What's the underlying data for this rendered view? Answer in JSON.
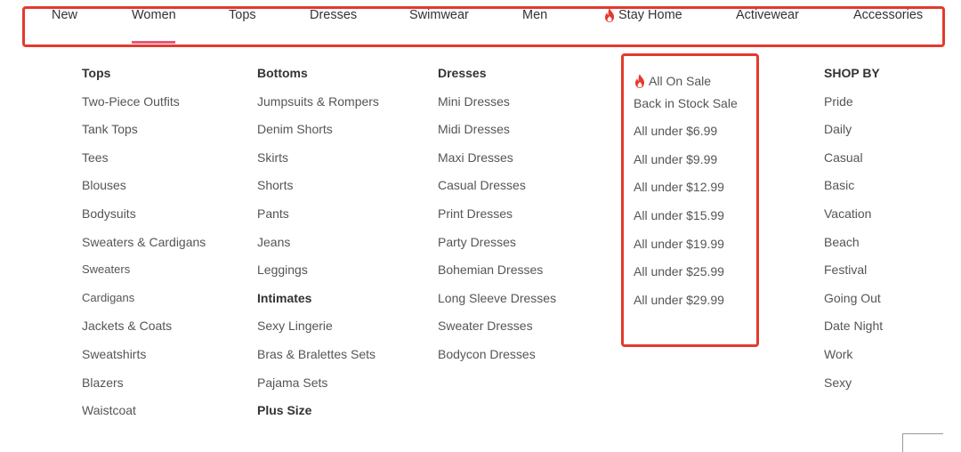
{
  "nav": {
    "items": [
      "New",
      "Women",
      "Tops",
      "Dresses",
      "Swimwear",
      "Men",
      "Stay Home",
      "Activewear",
      "Accessories"
    ],
    "active": "Women",
    "accent_color": "#e8567a",
    "highlight_color": "#e33a2c"
  },
  "columns": {
    "tops": {
      "heading": "Tops",
      "items": [
        "Two-Piece Outfits",
        "Tank Tops",
        "Tees",
        "Blouses",
        "Bodysuits",
        "Sweaters & Cardigans",
        "Sweaters",
        "Cardigans",
        "Jackets & Coats",
        "Sweatshirts",
        "Blazers",
        "Waistcoat"
      ]
    },
    "bottoms": {
      "heading": "Bottoms",
      "items": [
        "Jumpsuits & Rompers",
        "Denim Shorts",
        "Skirts",
        "Shorts",
        "Pants",
        "Jeans",
        "Leggings"
      ],
      "intimates_heading": "Intimates",
      "intimates": [
        "Sexy Lingerie",
        "Bras & Bralettes Sets",
        "Pajama Sets"
      ],
      "plus_heading": "Plus Size"
    },
    "dresses": {
      "heading": "Dresses",
      "items": [
        "Mini Dresses",
        "Midi Dresses",
        "Maxi Dresses",
        "Casual Dresses",
        "Print Dresses",
        "Party Dresses",
        "Bohemian Dresses",
        "Long Sleeve Dresses",
        "Sweater Dresses",
        "Bodycon Dresses"
      ]
    },
    "sale": {
      "heading": "All On Sale",
      "icon": "flame-icon",
      "items": [
        "Back in Stock Sale",
        "All under $6.99",
        "All under $9.99",
        "All under $12.99",
        "All under $15.99",
        "All under $19.99",
        "All under $25.99",
        "All under $29.99"
      ]
    },
    "shop_by": {
      "heading": "SHOP BY",
      "items": [
        "Pride",
        "Daily",
        "Casual",
        "Basic",
        "Vacation",
        "Beach",
        "Festival",
        "Going Out",
        "Date Night",
        "Work",
        "Sexy"
      ]
    }
  }
}
